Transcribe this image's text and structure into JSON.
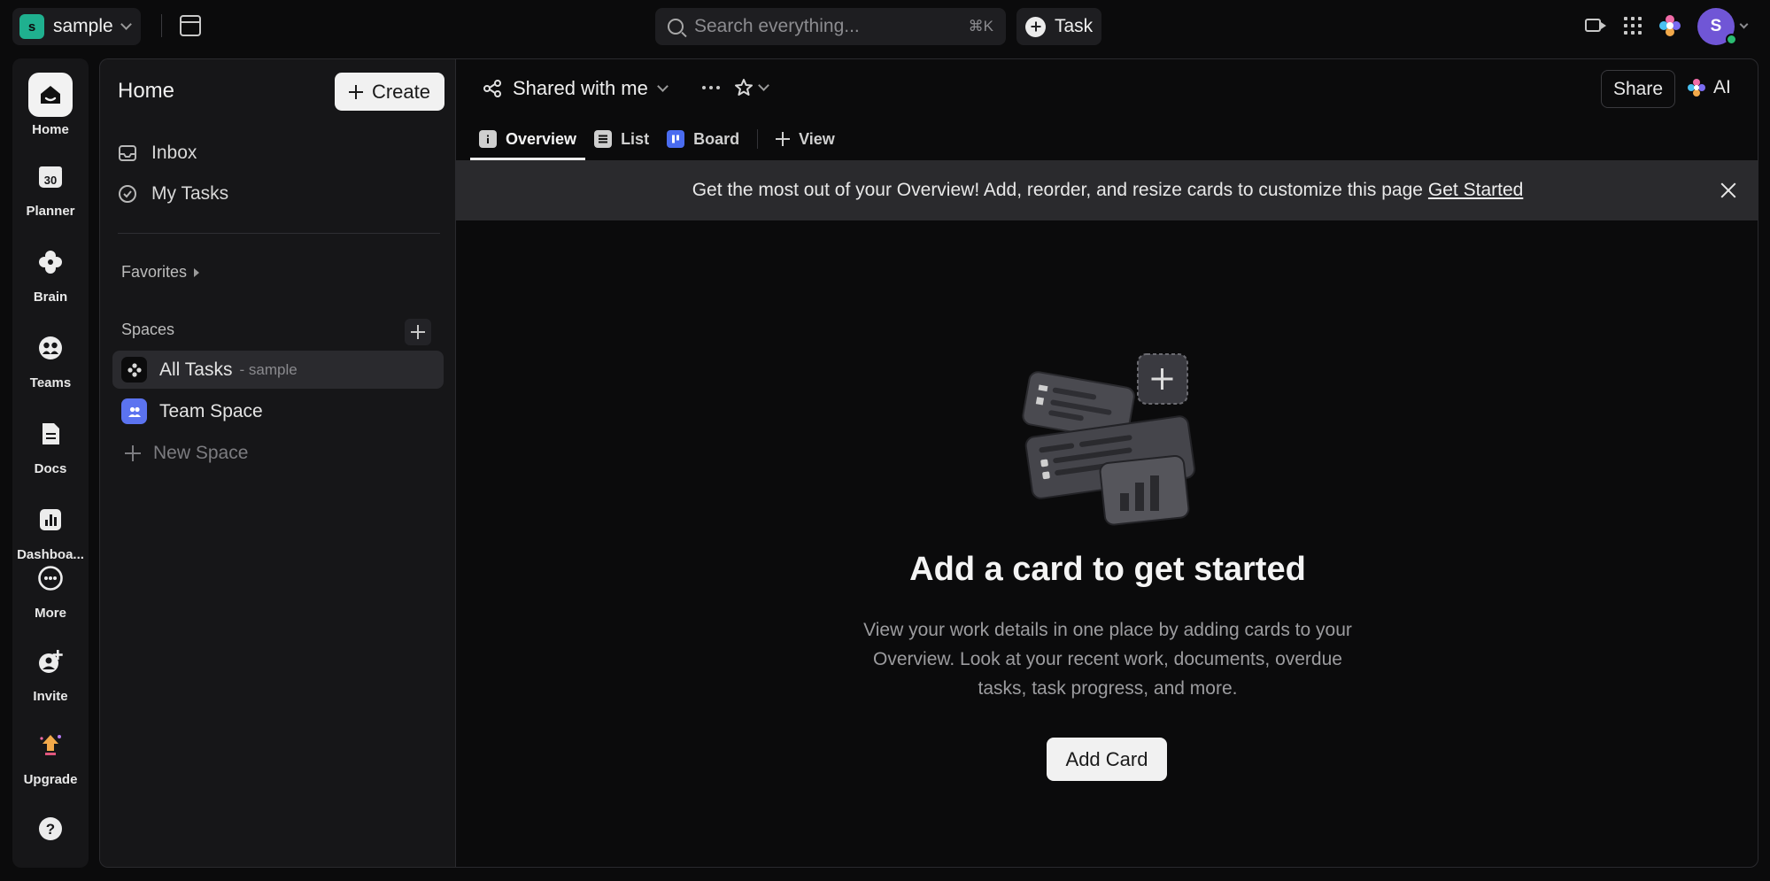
{
  "topbar": {
    "workspace_initial": "s",
    "workspace_name": "sample",
    "search_placeholder": "Search everything...",
    "search_shortcut": "⌘K",
    "task_label": "Task",
    "avatar_initial": "S",
    "icons": [
      "calendar-icon",
      "video-icon",
      "apps-grid-icon",
      "brain-logo-icon"
    ]
  },
  "rail": {
    "items": [
      {
        "label": "Home",
        "icon": "home-icon",
        "active": true
      },
      {
        "label": "Planner",
        "icon": "calendar-30-icon"
      },
      {
        "label": "Brain",
        "icon": "brain-icon"
      },
      {
        "label": "Teams",
        "icon": "teams-icon"
      },
      {
        "label": "Docs",
        "icon": "docs-icon"
      },
      {
        "label": "Dashboa...",
        "icon": "dashboard-icon"
      },
      {
        "label": "More",
        "icon": "more-icon"
      },
      {
        "label": "Invite",
        "icon": "invite-icon"
      },
      {
        "label": "Upgrade",
        "icon": "upgrade-icon"
      }
    ],
    "planner_day": "30"
  },
  "sidebar": {
    "title": "Home",
    "create_label": "Create",
    "nav": [
      {
        "label": "Inbox",
        "icon": "inbox-icon"
      },
      {
        "label": "My Tasks",
        "icon": "check-circle-icon"
      }
    ],
    "favorites_label": "Favorites",
    "spaces_label": "Spaces",
    "spaces": [
      {
        "label": "All Tasks",
        "sub": "- sample",
        "active": true
      },
      {
        "label": "Team Space"
      },
      {
        "label": "New Space"
      }
    ]
  },
  "main": {
    "breadcrumb": "Shared with me",
    "share_label": "Share",
    "ai_label": "AI",
    "tabs": [
      {
        "label": "Overview",
        "active": true
      },
      {
        "label": "List"
      },
      {
        "label": "Board"
      },
      {
        "label": "View"
      }
    ],
    "banner": {
      "text": "Get the most out of your Overview! Add, reorder, and resize cards to customize this page",
      "link": "Get Started"
    },
    "empty_state": {
      "title": "Add a card to get started",
      "description": "View your work details in one place by adding cards to your Overview. Look at your recent work, documents, overdue tasks, task progress, and more.",
      "button": "Add Card"
    }
  },
  "colors": {
    "background": "#0b0b0c",
    "panel": "#161618",
    "banner": "#2a2a2d",
    "workspace_badge": "#1fb08f",
    "avatar": "#7056d6",
    "presence": "#2bbc72",
    "team_space": "#5b73f0"
  }
}
